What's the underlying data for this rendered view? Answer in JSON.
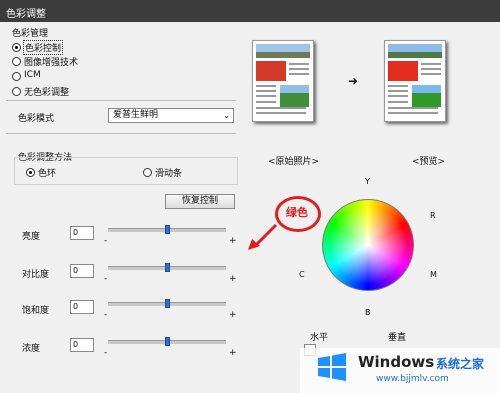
{
  "window": {
    "title": "色彩调整"
  },
  "color_management": {
    "group_label": "色彩管理",
    "options": [
      {
        "label": "色彩控制",
        "selected": true
      },
      {
        "label": "图像增强技术",
        "selected": false
      },
      {
        "label": "ICM",
        "selected": false
      },
      {
        "label": "无色彩调整",
        "selected": false
      }
    ]
  },
  "color_mode": {
    "label": "色彩模式",
    "value": "爱普生鲜明"
  },
  "adjust_method": {
    "group_label": "色彩调整方法",
    "options": [
      {
        "label": "色环",
        "selected": true
      },
      {
        "label": "滑动条",
        "selected": false
      }
    ]
  },
  "restore_button": "恢复控制",
  "sliders": [
    {
      "label": "亮度",
      "value": "0",
      "minus": "-",
      "plus": "+",
      "level": 0.5
    },
    {
      "label": "对比度",
      "value": "0",
      "minus": "-",
      "plus": "+",
      "level": 0.5
    },
    {
      "label": "饱和度",
      "value": "0",
      "minus": "-",
      "plus": "+",
      "level": 0.5
    },
    {
      "label": "浓度",
      "value": "0",
      "minus": "-",
      "plus": "+",
      "level": 0.5
    }
  ],
  "preview": {
    "original_label": "<原始照片>",
    "preview_label": "<预览>",
    "arrow": "➜"
  },
  "color_wheel": {
    "top": "Y",
    "right_top": "R",
    "right_bottom": "M",
    "left": "C",
    "bottom": "B",
    "annotation": "绿色",
    "annotation_color": "#e02020"
  },
  "bottom_labels": {
    "horizontal": "水平",
    "vertical": "垂直"
  },
  "watermark": {
    "brand": "Windows",
    "site_cn": "系统之家",
    "url": "www.bjjmlv.com"
  }
}
